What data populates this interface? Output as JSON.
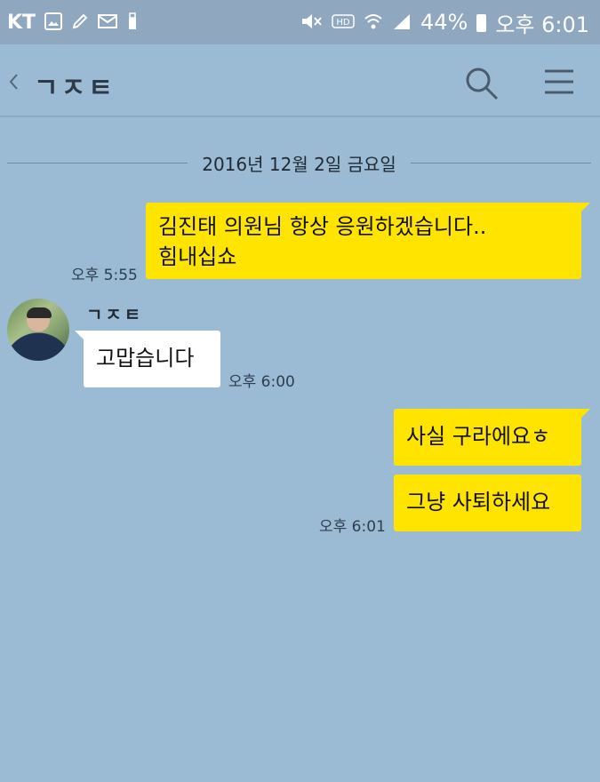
{
  "status_bar": {
    "carrier": "KT",
    "left_icons": [
      "image-icon",
      "pencil-icon",
      "mail-icon",
      "usb-icon"
    ],
    "right_icons": [
      "mute-icon",
      "hd-icon",
      "wifi-icon",
      "signal-icon"
    ],
    "battery": "44%",
    "clock": "오후 6:01"
  },
  "header": {
    "back_glyph": "〈",
    "title": "ㄱㅈㅌ",
    "search_icon": "search-icon",
    "menu_icon": "menu-icon"
  },
  "date_divider": "2016년 12월 2일 금요일",
  "messages": [
    {
      "from": "me",
      "lines": [
        "김진태 의원님 항상 응원하겠습니다..",
        "힘내십쇼"
      ],
      "time": "오후 5:55"
    },
    {
      "from": "them",
      "sender": "ㄱㅈㅌ",
      "text": "고맙습니다",
      "time": "오후 6:00"
    },
    {
      "from": "me",
      "text": "사실 구라에요ㅎ",
      "time": ""
    },
    {
      "from": "me",
      "text": "그냥 사퇴하세요",
      "time": "오후 6:01"
    }
  ],
  "colors": {
    "chat_background": "#9bbbd4",
    "my_bubble": "#ffe400",
    "their_bubble": "#ffffff",
    "status_bar": "#8fa7bf"
  }
}
